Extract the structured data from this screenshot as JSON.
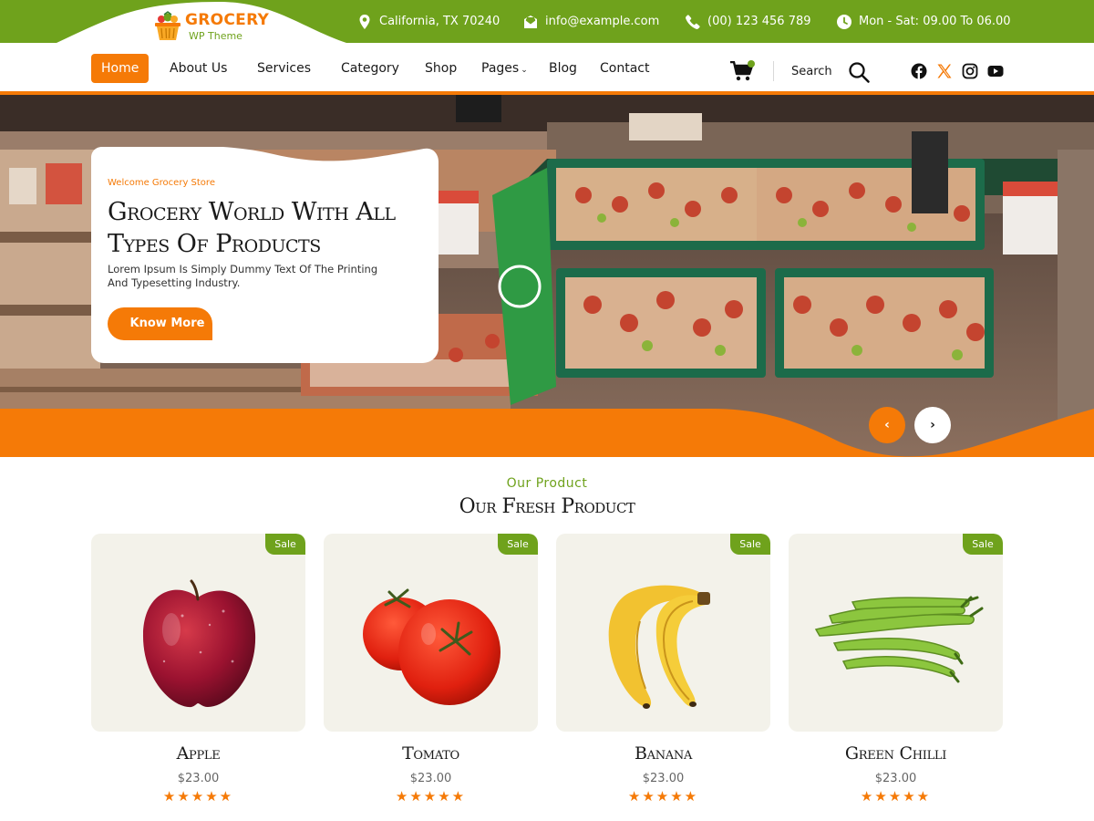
{
  "brand": {
    "title": "GROCERY",
    "subtitle": "WP Theme",
    "logo_icon": "basket-icon",
    "color_primary": "#6fa21c",
    "color_accent": "#f57a07"
  },
  "topbar": {
    "address": "California, TX 70240",
    "email": "info@example.com",
    "phone": "(00) 123 456 789",
    "hours": "Mon - Sat: 09.00 To 06.00"
  },
  "nav": {
    "items": [
      {
        "label": "Home",
        "active": true
      },
      {
        "label": "About Us"
      },
      {
        "label": "Services"
      },
      {
        "label": "Category"
      },
      {
        "label": "Shop"
      },
      {
        "label": "Pages"
      },
      {
        "label": "Blog"
      },
      {
        "label": "Contact"
      }
    ],
    "search_label": "Search",
    "icons": [
      "cart-icon",
      "search-icon",
      "facebook-icon",
      "x-icon",
      "instagram-icon",
      "youtube-icon"
    ]
  },
  "hero": {
    "eyebrow": "Welcome Grocery Store",
    "title": "Grocery World With All Types Of Products",
    "description": "Lorem Ipsum Is Simply Dummy Text Of The Printing And Typesetting Industry.",
    "button": "Know More",
    "prev_arrow": "‹",
    "next_arrow": "›"
  },
  "products_section": {
    "eyebrow": "Our Product",
    "title": "Our Fresh Product",
    "items": [
      {
        "name": "Apple",
        "price": "$23.00",
        "badge": "Sale",
        "rating": 5,
        "stars": "★★★★★"
      },
      {
        "name": "Tomato",
        "price": "$23.00",
        "badge": "Sale",
        "rating": 5,
        "stars": "★★★★★"
      },
      {
        "name": "Banana",
        "price": "$23.00",
        "badge": "Sale",
        "rating": 5,
        "stars": "★★★★★"
      },
      {
        "name": "Green Chilli",
        "price": "$23.00",
        "badge": "Sale",
        "rating": 5,
        "stars": "★★★★★"
      }
    ]
  }
}
